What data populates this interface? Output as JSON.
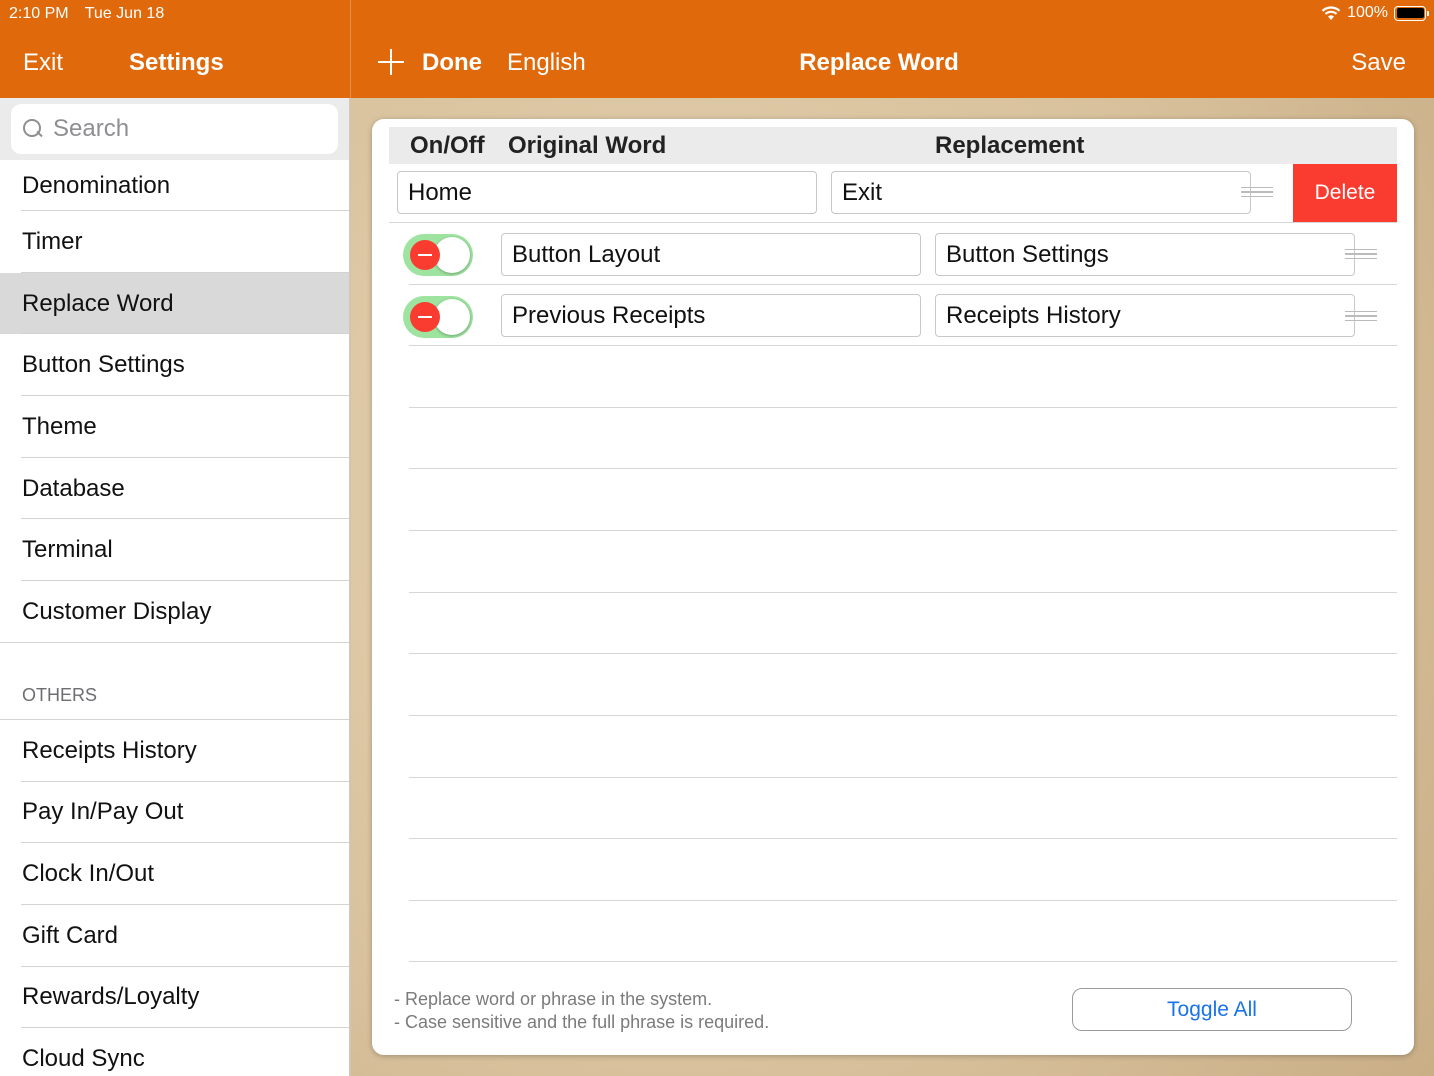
{
  "status": {
    "time": "2:10 PM",
    "date": "Tue Jun 18",
    "battery": "100%"
  },
  "nav": {
    "exit": "Exit",
    "settings": "Settings",
    "done": "Done",
    "language": "English",
    "title": "Replace Word",
    "save": "Save"
  },
  "sidebar": {
    "search_placeholder": "Search",
    "items": [
      "Denomination",
      "Timer",
      "Replace Word",
      "Button Settings",
      "Theme",
      "Database",
      "Terminal",
      "Customer Display"
    ],
    "selected": "Replace Word",
    "section_header": "OTHERS",
    "others": [
      "Receipts History",
      "Pay In/Pay Out",
      "Clock In/Out",
      "Gift Card",
      "Rewards/Loyalty",
      "Cloud Sync"
    ]
  },
  "table": {
    "headers": {
      "onoff": "On/Off",
      "original": "Original Word",
      "replacement": "Replacement"
    },
    "delete_label": "Delete",
    "rows": [
      {
        "original": "Home",
        "replacement": "Exit"
      },
      {
        "original": "Button Layout",
        "replacement": "Button Settings"
      },
      {
        "original": "Previous Receipts",
        "replacement": "Receipts History"
      }
    ]
  },
  "footer": {
    "note1": "- Replace word or phrase in the system.",
    "note2": "- Case sensitive and the full phrase is required.",
    "toggle_all": "Toggle All"
  },
  "colors": {
    "accent": "#e0690b",
    "delete": "#fa3b30",
    "toggle_on": "#9ee4a0",
    "link": "#1a73e8"
  },
  "icons": [
    "search-icon",
    "plus-icon",
    "wifi-icon",
    "battery-icon",
    "drag-handle-icon",
    "minus-circle-icon"
  ]
}
